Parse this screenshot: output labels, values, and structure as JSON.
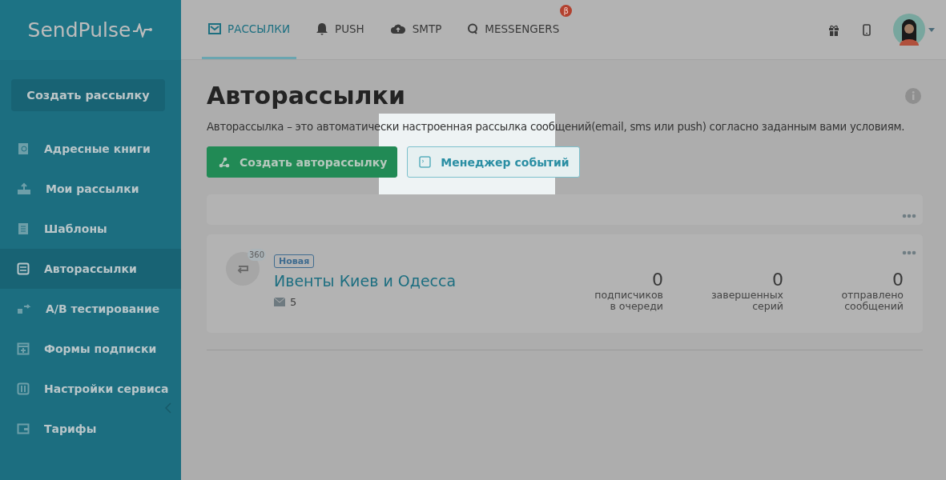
{
  "logo": "SendPulse",
  "tabs": [
    {
      "label": "РАССЫЛКИ",
      "kind": "mail",
      "selected": true
    },
    {
      "label": "PUSH",
      "kind": "bell",
      "selected": false
    },
    {
      "label": "SMTP",
      "kind": "cloud",
      "selected": false
    },
    {
      "label": "MESSENGERS",
      "kind": "chat",
      "selected": false,
      "badge": "β"
    }
  ],
  "sidebar": {
    "create_button": "Создать рассылку",
    "items": [
      {
        "label": "Адресные книги",
        "kind": "book",
        "selected": false
      },
      {
        "label": "Мои рассылки",
        "kind": "upload",
        "selected": false
      },
      {
        "label": "Шаблоны",
        "kind": "template",
        "selected": false
      },
      {
        "label": "Авторассылки",
        "kind": "flow",
        "selected": true
      },
      {
        "label": "A/B тестирование",
        "kind": "swap",
        "selected": false
      },
      {
        "label": "Формы подписки",
        "kind": "form",
        "selected": false
      },
      {
        "label": "Настройки сервиса",
        "kind": "sliders",
        "selected": false
      },
      {
        "label": "Тарифы",
        "kind": "wallet",
        "selected": false
      }
    ]
  },
  "page": {
    "title": "Авторассылки",
    "description": "Авторассылка – это автоматически настроенная рассылка сообщений(email, sms или push) согласно заданным вами условиям.",
    "buttons": [
      {
        "label": "Создать авторассылку",
        "kind": "primary"
      },
      {
        "label": "Менеджер событий",
        "kind": "secondary"
      }
    ],
    "campaigns": [
      {
        "count": "360",
        "status": "Новая",
        "name": "Ивенты Киев и Одесса",
        "emails": "5",
        "stats": [
          {
            "value": "0",
            "label": "подписчиков в очереди"
          },
          {
            "value": "0",
            "label": "завершенных серий"
          },
          {
            "value": "0",
            "label": "отправлено сообщений"
          }
        ]
      }
    ]
  }
}
